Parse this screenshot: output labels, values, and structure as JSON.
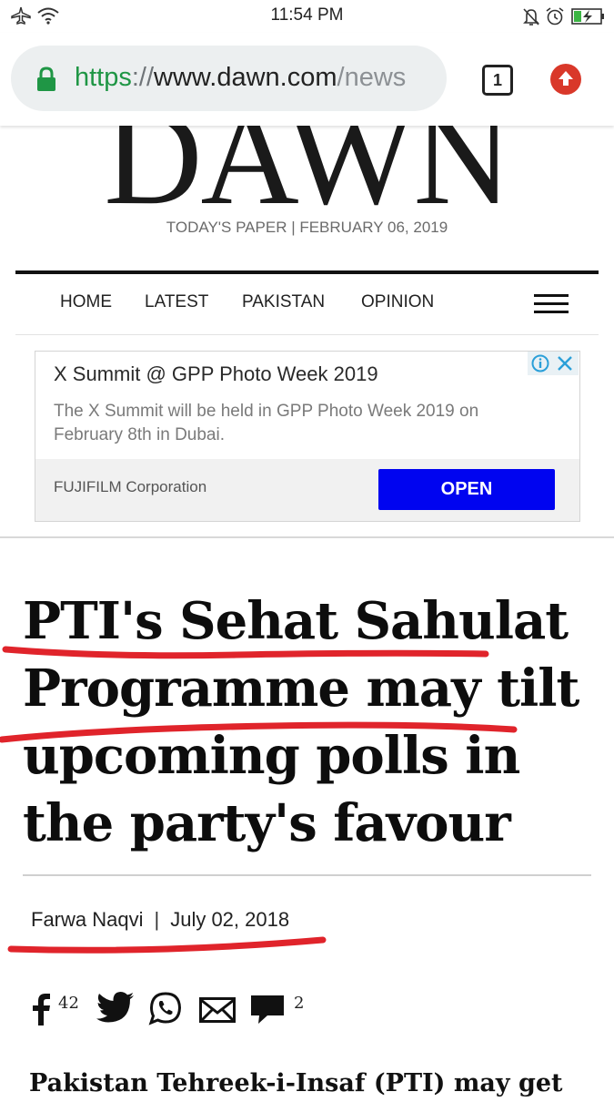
{
  "status_bar": {
    "time": "11:54 PM",
    "icons": [
      "airplane-icon",
      "wifi-icon",
      "notifications-off-icon",
      "alarm-icon",
      "battery-charging-icon"
    ]
  },
  "browser": {
    "url_scheme": "https",
    "url_separator": "://",
    "url_host": "www.dawn.com",
    "url_path": "/news",
    "tab_count": "1",
    "accent_color": "#1f9645"
  },
  "masthead": {
    "logo_text": "DAWN",
    "todays_paper": "TODAY'S PAPER | FEBRUARY 06, 2019"
  },
  "nav": {
    "items": [
      "HOME",
      "LATEST",
      "PAKISTAN",
      "OPINION"
    ]
  },
  "ad": {
    "title": "X Summit @ GPP Photo Week 2019",
    "description": "The X Summit will be held in GPP Photo Week 2019 on February 8th in Dubai.",
    "advertiser": "FUJIFILM Corporation",
    "cta": "OPEN",
    "cta_color": "#0004f0"
  },
  "article": {
    "headline": "PTI's Sehat Sahulat Programme may tilt upcoming polls in the party's favour",
    "author": "Farwa Naqvi",
    "date": "July 02, 2018",
    "body_start": "Pakistan Tehreek-i-Insaf (PTI) may get",
    "underline_color": "#e0242b"
  },
  "share": {
    "facebook_count": "42",
    "comment_count": "2"
  }
}
